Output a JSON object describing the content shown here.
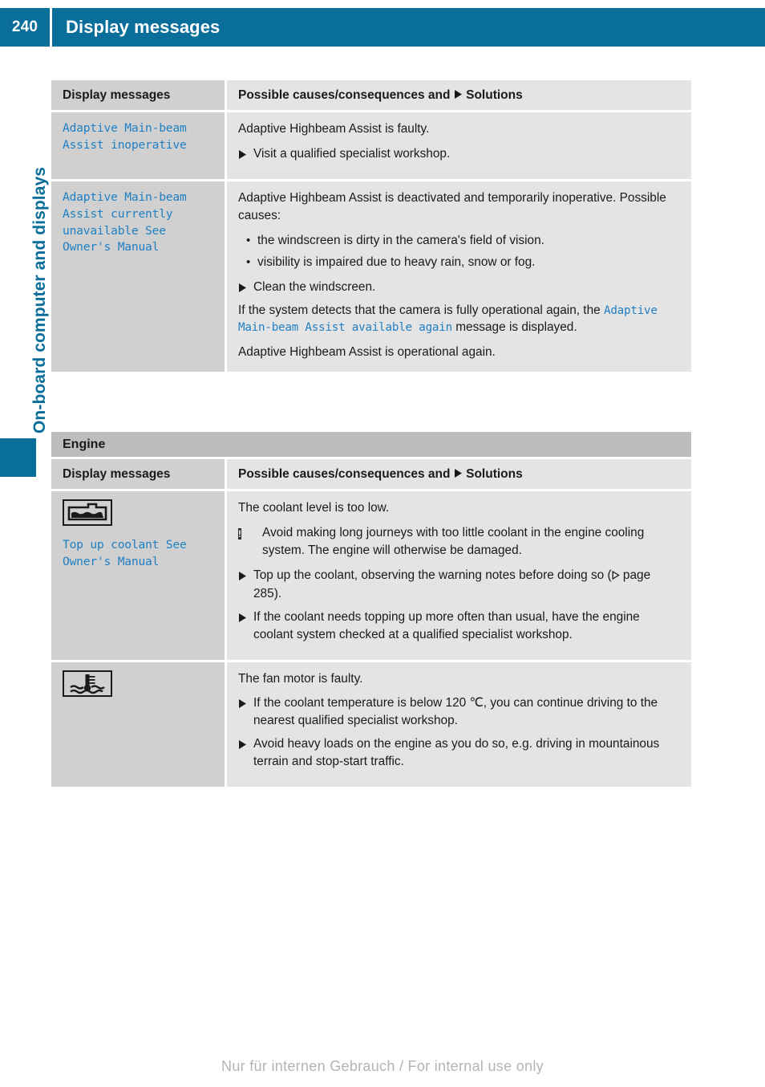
{
  "header": {
    "page_number": "240",
    "title": "Display messages",
    "accent_color": "#0a6e9b"
  },
  "sidebar": {
    "chapter_label": "On-board computer and displays",
    "marker_color": "#0a6e9b"
  },
  "tables": [
    {
      "id": "table-adaptive-main-beam",
      "section_band": null,
      "columns": {
        "left": "Display messages",
        "right_prefix": "Possible causes/consequences and",
        "right_suffix": "Solutions"
      },
      "rows": [
        {
          "message": "Adaptive Main-beam\nAssist inoperative",
          "icon": null,
          "blocks": [
            {
              "type": "paragraph",
              "text": "Adaptive Highbeam Assist is faulty."
            },
            {
              "type": "step",
              "text": "Visit a qualified specialist workshop."
            }
          ]
        },
        {
          "message": "Adaptive Main-beam\nAssist currently\nunavailable See\nOwner's Manual",
          "icon": null,
          "blocks": [
            {
              "type": "paragraph",
              "text": "Adaptive Highbeam Assist is deactivated and temporarily inoperative. Possible causes:"
            },
            {
              "type": "bullet",
              "text": "the windscreen is dirty in the camera's field of vision."
            },
            {
              "type": "bullet",
              "text": "visibility is impaired due to heavy rain, snow or fog."
            },
            {
              "type": "step",
              "text": "Clean the windscreen."
            },
            {
              "type": "paragraph-mixed",
              "pre": "If the system detects that the camera is fully operational again, the ",
              "message": "Adaptive Main-beam Assist available again",
              "post": " message is displayed."
            },
            {
              "type": "paragraph",
              "text": "Adaptive Highbeam Assist is operational again."
            }
          ]
        }
      ]
    },
    {
      "id": "table-engine",
      "section_band": "Engine",
      "columns": {
        "left": "Display messages",
        "right_prefix": "Possible causes/consequences and",
        "right_suffix": "Solutions"
      },
      "rows": [
        {
          "message": "Top up coolant See\nOwner's Manual",
          "icon": "coolant-level-icon",
          "blocks": [
            {
              "type": "paragraph",
              "text": "The coolant level is too low."
            },
            {
              "type": "note",
              "marker": "!",
              "text": "Avoid making long journeys with too little coolant in the engine cooling system. The engine will otherwise be damaged."
            },
            {
              "type": "step-pageref",
              "pre": "Top up the coolant, observing the warning notes before doing so (",
              "page_label": "page 285",
              "post": ")."
            },
            {
              "type": "step",
              "text": "If the coolant needs topping up more often than usual, have the engine coolant system checked at a qualified specialist workshop."
            }
          ]
        },
        {
          "message": "",
          "icon": "coolant-temperature-icon",
          "blocks": [
            {
              "type": "paragraph",
              "text": "The fan motor is faulty."
            },
            {
              "type": "step",
              "text": "If the coolant temperature is below 120 ℃, you can continue driving to the nearest qualified specialist workshop."
            },
            {
              "type": "step",
              "text": "Avoid heavy loads on the engine as you do so, e.g. driving in mountainous terrain and stop-start traffic."
            }
          ]
        }
      ]
    }
  ],
  "footer": {
    "text": "Nur für internen Gebrauch / For internal use only"
  }
}
